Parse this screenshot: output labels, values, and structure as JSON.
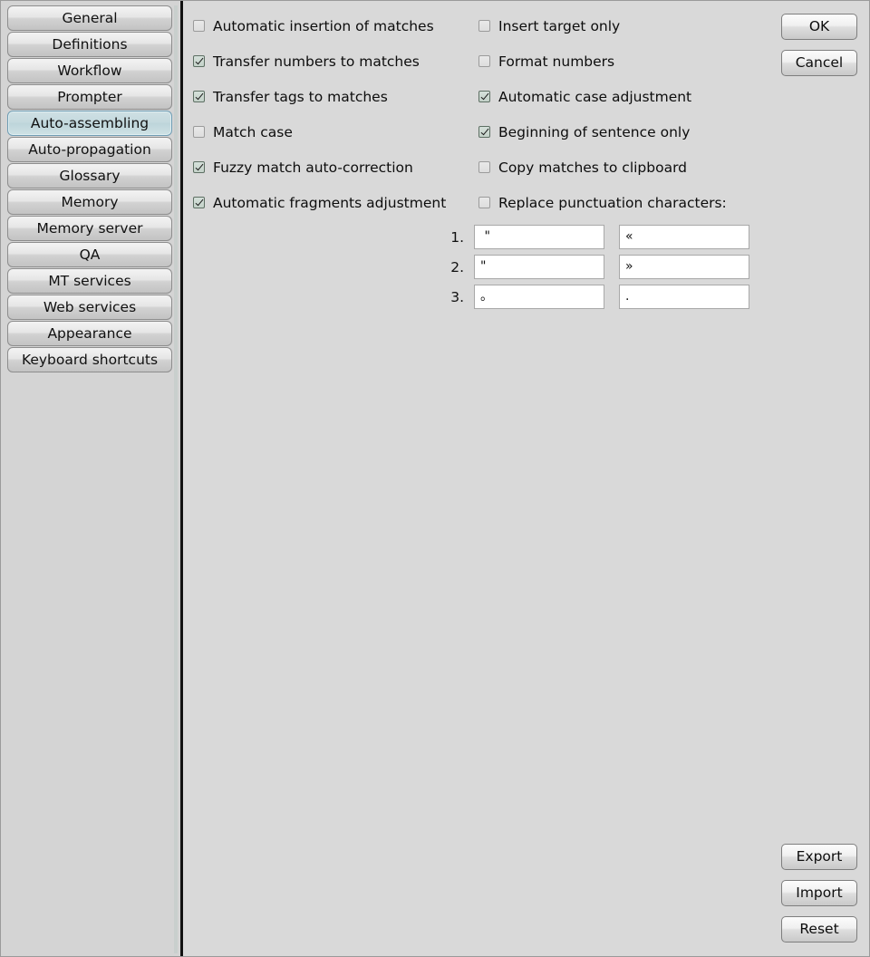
{
  "sidebar": {
    "items": [
      {
        "label": "General",
        "selected": false
      },
      {
        "label": "Definitions",
        "selected": false
      },
      {
        "label": "Workflow",
        "selected": false
      },
      {
        "label": "Prompter",
        "selected": false
      },
      {
        "label": "Auto-assembling",
        "selected": true
      },
      {
        "label": "Auto-propagation",
        "selected": false
      },
      {
        "label": "Glossary",
        "selected": false
      },
      {
        "label": "Memory",
        "selected": false
      },
      {
        "label": "Memory server",
        "selected": false
      },
      {
        "label": "QA",
        "selected": false
      },
      {
        "label": "MT services",
        "selected": false
      },
      {
        "label": "Web services",
        "selected": false
      },
      {
        "label": "Appearance",
        "selected": false
      },
      {
        "label": "Keyboard shortcuts",
        "selected": false
      }
    ]
  },
  "options": {
    "left_column": [
      {
        "label": "Automatic insertion of matches",
        "checked": false
      },
      {
        "label": "Transfer numbers to matches",
        "checked": true
      },
      {
        "label": "Transfer tags to matches",
        "checked": true
      },
      {
        "label": "Match case",
        "checked": false
      },
      {
        "label": "Fuzzy match auto-correction",
        "checked": true
      },
      {
        "label": "Automatic fragments adjustment",
        "checked": true
      }
    ],
    "right_column": [
      {
        "label": "Insert target only",
        "checked": false
      },
      {
        "label": "Format numbers",
        "checked": false
      },
      {
        "label": "Automatic case adjustment",
        "checked": true
      },
      {
        "label": "Beginning of sentence only",
        "checked": true
      },
      {
        "label": "Copy matches to clipboard",
        "checked": false
      },
      {
        "label": "Replace punctuation characters:",
        "checked": false
      }
    ]
  },
  "punctuation": {
    "rows": [
      {
        "number": "1.",
        "from": " \"",
        "to": "«"
      },
      {
        "number": "2.",
        "from": "\"",
        "to": "»"
      },
      {
        "number": "3.",
        "from": "。",
        "to": "."
      }
    ]
  },
  "buttons": {
    "ok": "OK",
    "cancel": "Cancel",
    "export": "Export",
    "import": "Import",
    "reset": "Reset"
  },
  "colors": {
    "window_background": "#d4d4d4",
    "panel_background": "#d9d9d9",
    "selected_nav": "#c4d9de",
    "selected_nav_border": "#6f9cb3",
    "checkbox_checked": "#c4d2c9",
    "divider": "#111111"
  }
}
